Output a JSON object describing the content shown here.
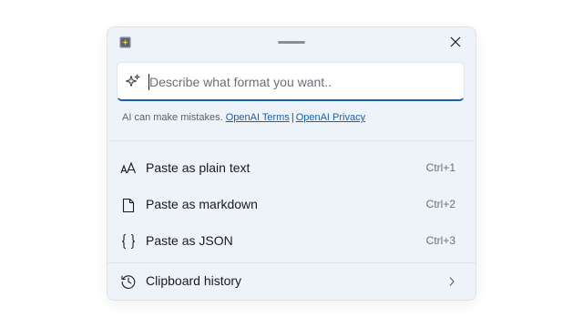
{
  "prompt": {
    "placeholder": "Describe what format you want..",
    "value": ""
  },
  "disclaimer": {
    "text": "AI can make mistakes.",
    "terms_link": "OpenAI Terms",
    "separator": "|",
    "privacy_link": "OpenAI Privacy"
  },
  "menu": [
    {
      "label": "Paste as plain text",
      "shortcut": "Ctrl+1",
      "icon": "font-size-icon"
    },
    {
      "label": "Paste as markdown",
      "shortcut": "Ctrl+2",
      "icon": "document-icon"
    },
    {
      "label": "Paste as JSON",
      "shortcut": "Ctrl+3",
      "icon": "braces-icon"
    }
  ],
  "history": {
    "label": "Clipboard history",
    "icon": "history-icon"
  },
  "icons": {
    "app": "app-icon",
    "close": "close-icon",
    "sparkle": "sparkle-icon",
    "chevron": "chevron-right-icon"
  },
  "colors": {
    "background": "#eef3fa",
    "accent": "#1b5fa8",
    "text": "#1a1a1a",
    "muted": "#6b6f75"
  }
}
